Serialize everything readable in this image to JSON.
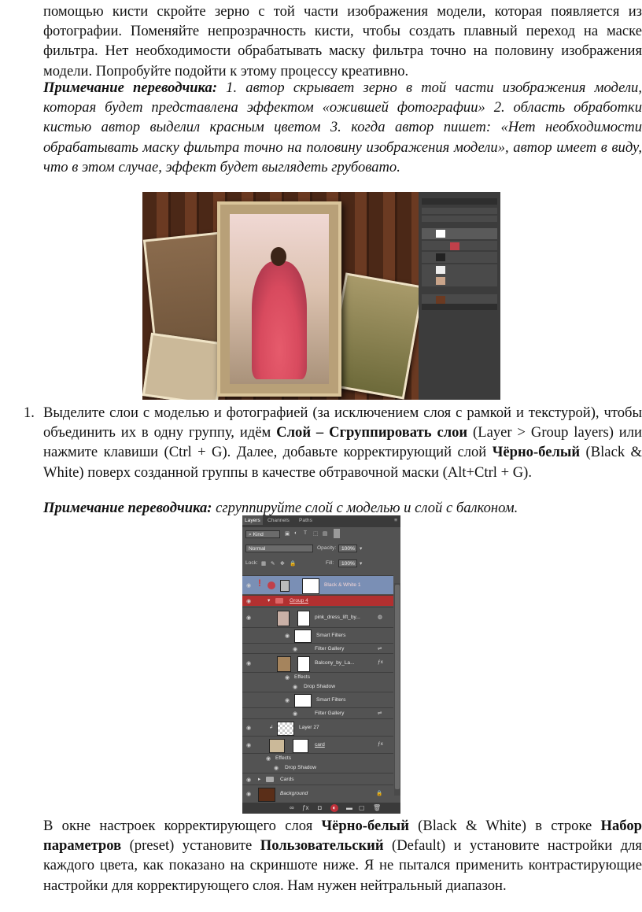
{
  "p1": "помощью кисти скройте зерно с той части изображения модели, которая появляется из фотографии. Поменяйте непрозрачность кисти, чтобы создать плавный переход на маске фильтра. Нет необходимости обрабатывать маску фильтра точно на половину изображения модели. Попробуйте подойти к этому процессу креативно.",
  "note1_label": "Примечание переводчика:",
  "note1_text": " 1. автор скрывает зерно в той части изображения модели, которая будет представлена эффектом «ожившей фотографии» 2. область обработки кистью автор выделил красным цветом 3. когда автор пишет: «Нет необходимости обрабатывать маску фильтра точно на половину изображения модели», автор имеет в виду, что в этом случае, эффект будет выглядеть грубовато.",
  "step_number": "1.",
  "step_a": "Выделите слои с моделью и фотографией (за исключением слоя с рамкой и текстурой), чтобы объединить их в одну группу, идём ",
  "step_b": "Слой – Сгруппировать слои",
  "step_c": " (Layer > Group layers) или нажмите клавиши (Ctrl + G). Далее, добавьте корректирующий слой ",
  "step_d": "Чёрно-белый",
  "step_e": " (Black & White) поверх созданной группы в качестве обтравочной маски (Alt+Ctrl + G).",
  "note2_label": "Примечание переводчика:",
  "note2_text": " сгруппируйте слой с моделью и слой с балконом.",
  "p3_a": "В окне настроек корректирующего слоя ",
  "p3_b": "Чёрно-белый",
  "p3_c": " (Black & White) в строке ",
  "p3_d": "Набор параметров",
  "p3_e": " (preset) установите ",
  "p3_f": "Пользовательский",
  "p3_g": " (Default) и установите настройки для каждого цвета, как показано на скриншоте ниже. Я не пытался применить контрастирующие настройки для корректирующего слоя. Нам нужен нейтральный диапазон.",
  "panel": {
    "tabs": [
      "Layers",
      "Channels",
      "Paths"
    ],
    "kind": "Kind",
    "blend_mode": "Normal",
    "opacity_label": "Opacity:",
    "opacity_value": "100%",
    "lock_label": "Lock:",
    "fill_label": "Fill:",
    "fill_value": "100%",
    "layers": [
      {
        "name": "Black & White 1"
      },
      {
        "name": "Group 4"
      },
      {
        "name": "pink_dress_lift_by..."
      },
      {
        "name": "Smart Filters"
      },
      {
        "name": "Filter Gallery"
      },
      {
        "name": "Balcony_by_La..."
      },
      {
        "name": "Effects"
      },
      {
        "name": "Drop Shadow"
      },
      {
        "name": "Smart Filters"
      },
      {
        "name": "Filter Gallery"
      },
      {
        "name": "Layer 27"
      },
      {
        "name": "card"
      },
      {
        "name": "Effects"
      },
      {
        "name": "Drop Shadow"
      },
      {
        "name": "Cards"
      },
      {
        "name": "Background"
      }
    ]
  },
  "colors": {
    "highlight_layer": "#7a8fb5",
    "group_red": "#b23030"
  }
}
